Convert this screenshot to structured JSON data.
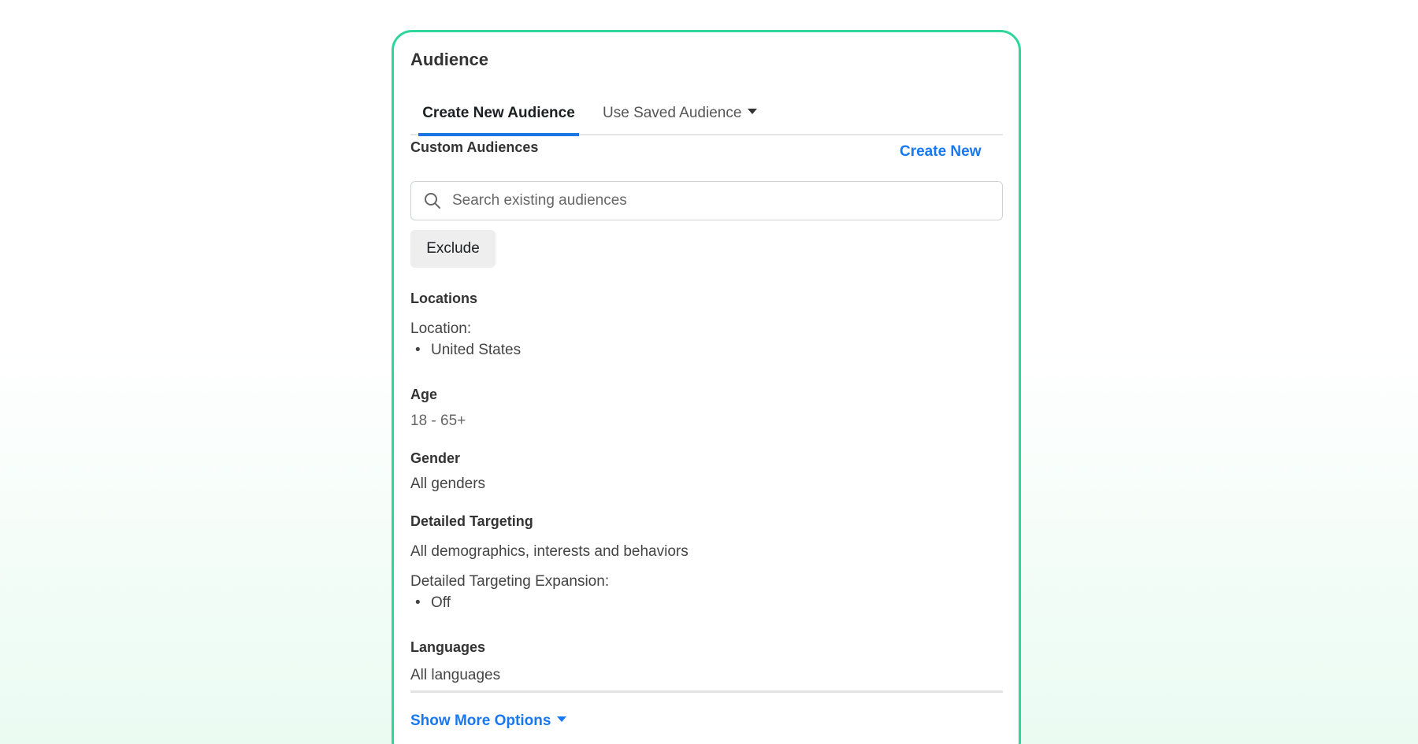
{
  "panel": {
    "title": "Audience"
  },
  "tabs": [
    {
      "label": "Create New Audience",
      "active": true
    },
    {
      "label": "Use Saved Audience",
      "active": false,
      "has_dropdown": true
    }
  ],
  "custom_audiences": {
    "label": "Custom Audiences",
    "create_new_label": "Create New",
    "search_placeholder": "Search existing audiences",
    "search_value": "",
    "exclude_label": "Exclude"
  },
  "locations": {
    "label": "Locations",
    "sub_label": "Location:",
    "items": [
      "United States"
    ]
  },
  "age": {
    "label": "Age",
    "value": "18 - 65+"
  },
  "gender": {
    "label": "Gender",
    "value": "All genders"
  },
  "detailed_targeting": {
    "label": "Detailed Targeting",
    "value": "All demographics, interests and behaviors",
    "expansion_label": "Detailed Targeting Expansion:",
    "expansion_items": [
      "Off"
    ]
  },
  "languages": {
    "label": "Languages",
    "value": "All languages"
  },
  "show_more": {
    "label": "Show More Options"
  },
  "colors": {
    "accent_border": "#2ed69a",
    "link_blue": "#1877f2",
    "tab_underline": "#1b74e4"
  },
  "icons": {
    "search": "search-icon",
    "dropdown": "caret-down-icon"
  }
}
